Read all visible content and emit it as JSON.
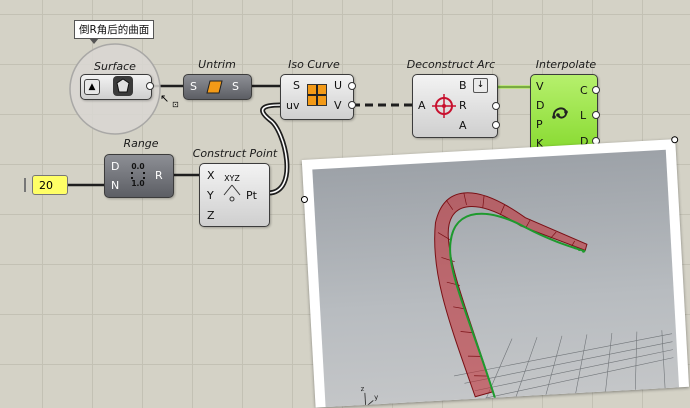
{
  "tooltip": "倒R角后的曲面",
  "nodes": {
    "surface": {
      "title": "Surface"
    },
    "untrim": {
      "title": "Untrim",
      "in": "S",
      "out": "S"
    },
    "iso_curve": {
      "title": "Iso Curve",
      "in": [
        "S",
        "uv"
      ],
      "out": [
        "U",
        "V"
      ]
    },
    "deconstruct_arc": {
      "title": "Deconstruct Arc",
      "in": [
        "A"
      ],
      "out": [
        "B",
        "R",
        "A"
      ]
    },
    "interpolate": {
      "title": "Interpolate",
      "in": [
        "V",
        "D",
        "P",
        "K"
      ],
      "out": [
        "C",
        "L",
        "D"
      ]
    },
    "range": {
      "title": "Range",
      "in": [
        "D",
        "N"
      ],
      "out": [
        "R"
      ],
      "icon_text": [
        "0.0",
        "1.0"
      ]
    },
    "construct_point": {
      "title": "Construct Point",
      "in": [
        "X",
        "Y",
        "Z"
      ],
      "out": [
        "Pt"
      ],
      "icon_text": "XYZ"
    }
  },
  "slider": {
    "value": "20"
  },
  "viewport": {
    "axis_labels": [
      "z",
      "y",
      "x"
    ]
  },
  "colors": {
    "canvas": "#d4d2c6",
    "interpolate_node": "#9be34b",
    "slider": "#ffff66",
    "curve_green": "#1e9a2e",
    "surface_red": "#c1272d"
  }
}
